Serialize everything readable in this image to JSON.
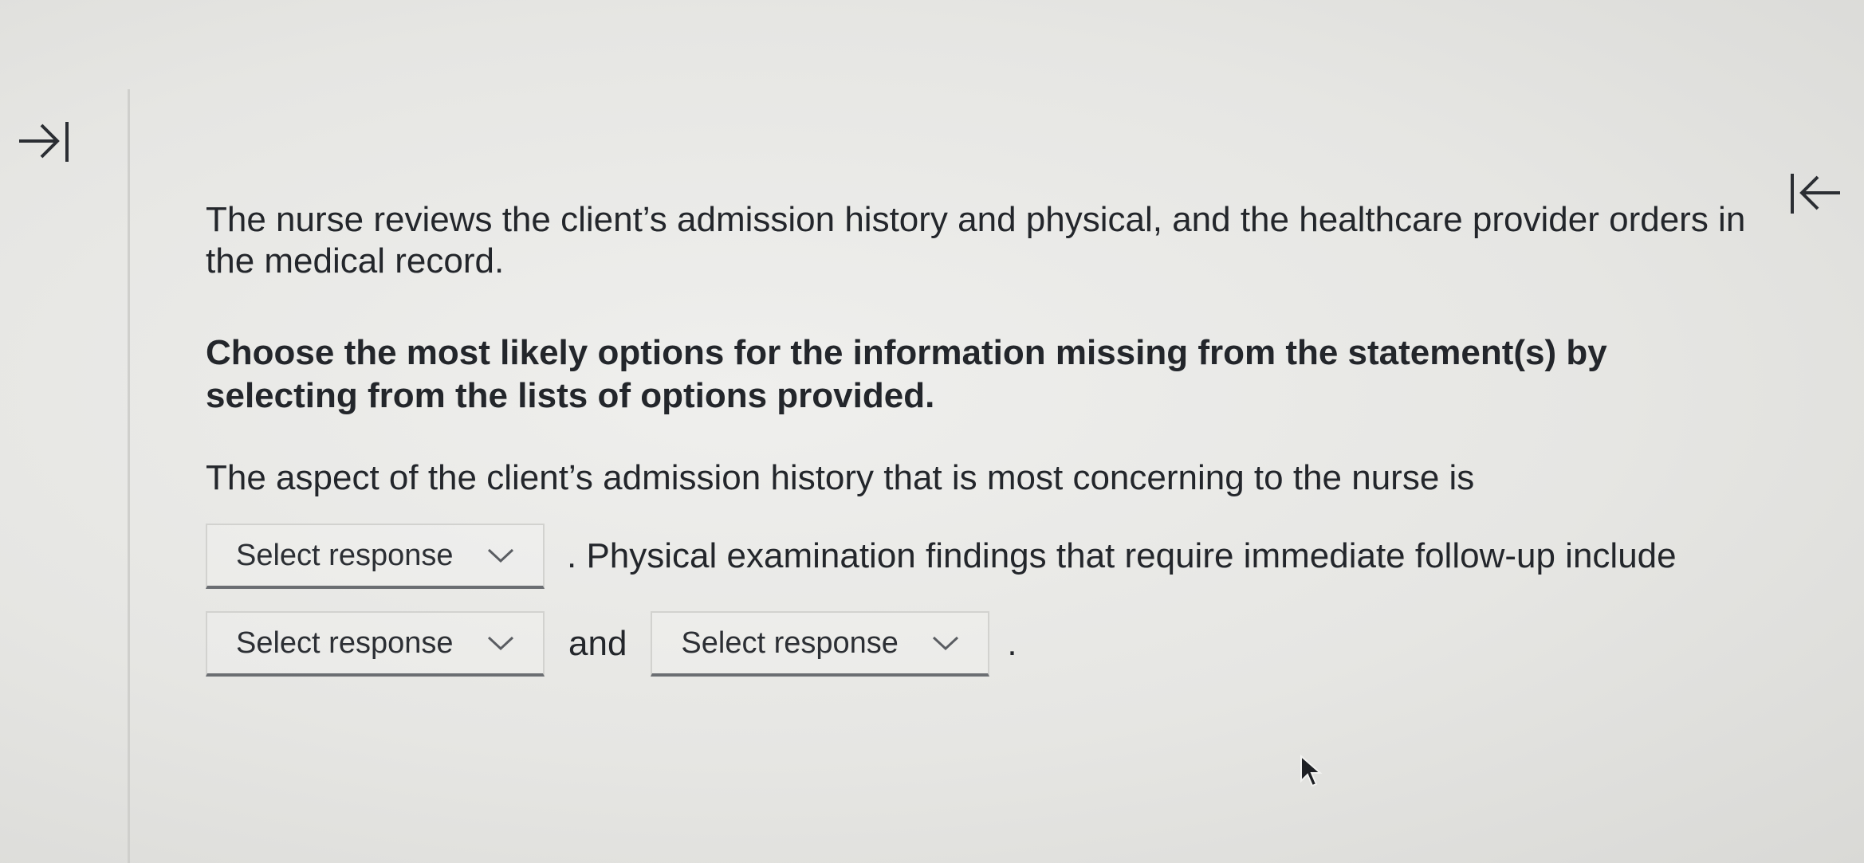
{
  "question": {
    "stem": "The nurse reviews the client’s admission history and physical, and the healthcare provider orders in the medical record.",
    "instruction": "Choose the most likely options for the information missing from the statement(s) by selecting from the lists of options provided.",
    "cloze": {
      "part1": "The aspect of the client’s admission history that is most concerning to the nurse is",
      "part2": ". Physical examination findings that require immediate follow-up include",
      "part3": "and",
      "part4": ".",
      "dropdowns": [
        {
          "label": "Select response"
        },
        {
          "label": "Select response"
        },
        {
          "label": "Select response"
        }
      ]
    }
  },
  "icons": {
    "expand": "arrow-right-to-bar-icon",
    "collapse": "arrow-left-from-bar-icon",
    "dropdown": "chevron-down-icon",
    "cursor": "mouse-pointer-icon"
  }
}
